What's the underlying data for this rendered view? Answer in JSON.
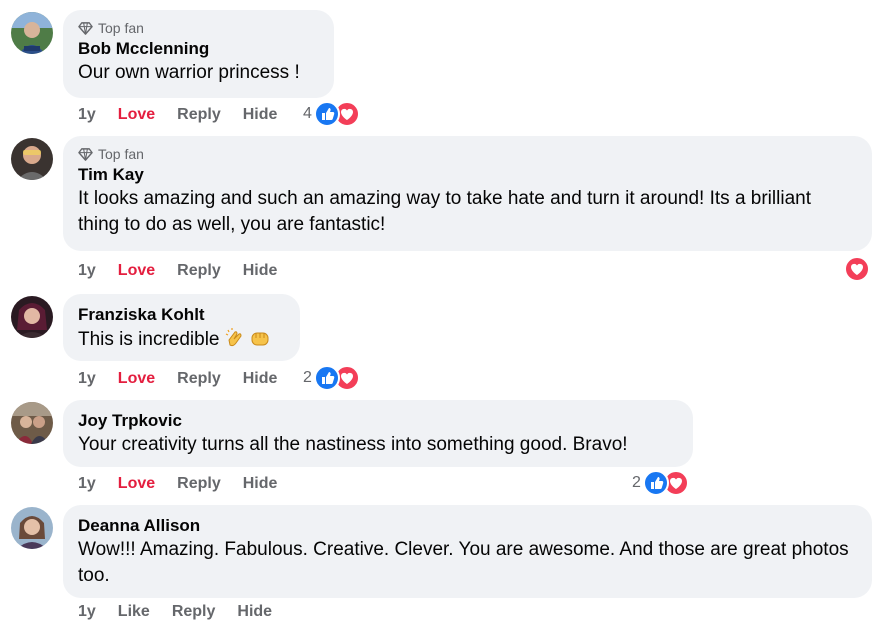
{
  "comments": [
    {
      "badge": "Top fan",
      "name": "Bob Mcclenning",
      "text": "Our own warrior princess !",
      "time": "1y",
      "reaction_action": "Love",
      "reply": "Reply",
      "hide": "Hide",
      "reaction_count": "4",
      "reactions": [
        "like-icon",
        "love-icon"
      ],
      "avatar_icon": "avatar-photo",
      "avatar_color": "#3b6a3a"
    },
    {
      "badge": "Top fan",
      "name": "Tim Kay",
      "text": "It looks amazing and such an amazing way to take hate and turn it around! Its a brilliant thing to do as well, you are fantastic!",
      "time": "1y",
      "reaction_action": "Love",
      "reply": "Reply",
      "hide": "Hide",
      "reaction_count": "",
      "reactions": [
        "love-icon"
      ],
      "avatar_icon": "avatar-photo",
      "avatar_color": "#6b5a4e"
    },
    {
      "badge": "",
      "name": "Franziska Kohlt",
      "text": "This is incredible",
      "emojis": [
        "clapping-hands-emoji",
        "fist-emoji"
      ],
      "time": "1y",
      "reaction_action": "Love",
      "reply": "Reply",
      "hide": "Hide",
      "reaction_count": "2",
      "reactions": [
        "like-icon",
        "love-icon"
      ],
      "avatar_icon": "avatar-photo",
      "avatar_color": "#4a2230"
    },
    {
      "badge": "",
      "name": "Joy Trpkovic",
      "text": "Your creativity turns all the nastiness into something good. Bravo!",
      "time": "1y",
      "reaction_action": "Love",
      "reply": "Reply",
      "hide": "Hide",
      "reaction_count": "2",
      "reactions": [
        "like-icon",
        "love-icon"
      ],
      "avatar_icon": "avatar-photo",
      "avatar_color": "#5a4a3a"
    },
    {
      "badge": "",
      "name": "Deanna Allison",
      "text": "Wow!!! Amazing. Fabulous. Creative. Clever. You are awesome. And those are great photos too.",
      "time": "1y",
      "reaction_action": "Like",
      "reply": "Reply",
      "hide": "Hide",
      "reaction_count": "",
      "reactions": [],
      "avatar_icon": "avatar-photo",
      "avatar_color": "#8a6a5a"
    }
  ],
  "colors": {
    "bubble": "#f0f2f5",
    "love_action": "#e41e3f",
    "like_blue": "#1877f2",
    "love_red": "#f33e58",
    "muted": "#65676b"
  }
}
